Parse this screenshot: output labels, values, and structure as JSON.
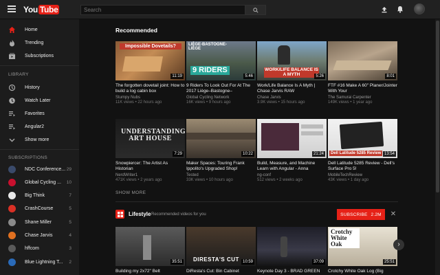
{
  "header": {
    "logo_you": "You",
    "logo_tube": "Tube",
    "search_placeholder": "Search"
  },
  "sidebar": {
    "main": [
      {
        "label": "Home",
        "icon": "home-icon"
      },
      {
        "label": "Trending",
        "icon": "flame-icon"
      },
      {
        "label": "Subscriptions",
        "icon": "subscriptions-icon"
      }
    ],
    "library_heading": "LIBRARY",
    "library": [
      {
        "label": "History",
        "icon": "history-icon"
      },
      {
        "label": "Watch Later",
        "icon": "clock-icon"
      },
      {
        "label": "Favorites",
        "icon": "heart-icon"
      },
      {
        "label": "Angular2",
        "icon": "playlist-icon"
      },
      {
        "label": "Show more",
        "icon": "chevron-down-icon"
      }
    ],
    "subscriptions_heading": "SUBSCRIPTIONS",
    "subscriptions": [
      {
        "label": "NDC Conference...",
        "count": "29",
        "color": "#3a4a6a"
      },
      {
        "label": "Global Cycling ...",
        "count": "10",
        "color": "#c8102e"
      },
      {
        "label": "Big Think",
        "count": "7",
        "color": "#e8e8e8"
      },
      {
        "label": "CrashCourse",
        "count": "5",
        "color": "#d93025"
      },
      {
        "label": "Shane Miller",
        "count": "5",
        "color": "#8a8a8a"
      },
      {
        "label": "Chase Jarvis",
        "count": "4",
        "color": "#e07020"
      },
      {
        "label": "hffcom",
        "count": "3",
        "color": "#5a5a5a"
      },
      {
        "label": "Blue Lightning T...",
        "count": "2",
        "color": "#2a6ab8"
      }
    ]
  },
  "recommended": {
    "title": "Recommended",
    "show_more": "SHOW MORE",
    "videos": [
      {
        "title": "The forgotten dovetail joint: How to build a log cabin box",
        "channel": "Stumpy Nubs",
        "meta": "11K views • 22 hours ago",
        "duration": "11:19",
        "thumb_text": "Impossible Dovetails?"
      },
      {
        "title": "9 Riders To Look Out For At The 2017 Liège–Bastogne–",
        "channel": "Global Cycling Network",
        "meta": "16K views • 9 hours ago",
        "duration": "5:46",
        "thumb_text": "9 RIDERS",
        "thumb_text2": "LIÈGE-BASTOGNE-LIÈGE"
      },
      {
        "title": "Work/Life Balance Is A Myth | Chase Jarvis RAW",
        "channel": "Chase Jarvis",
        "meta": "3.9K views • 15 hours ago",
        "duration": "5:26",
        "thumb_text": "WORK/LIFE BALANCE IS A MYTH"
      },
      {
        "title": "FTF #16 Make A 60\" Planer/Jointer With Your",
        "channel": "The Samurai Carpenter",
        "meta": "149K views • 1 year ago",
        "duration": "8:01"
      },
      {
        "title": "Snowpiercer: The Artist As Historian",
        "channel": "NerdWriter1",
        "meta": "471K views • 2 years ago",
        "duration": "7:29",
        "thumb_text": "UNDERSTANDING ART HOUSE"
      },
      {
        "title": "Maker Spaces: Touring Frank Ippolito's Upgraded Shop!",
        "channel": "Tested",
        "meta": "33K views • 10 hours ago",
        "duration": "10:22"
      },
      {
        "title": "Build, Measure, and Machine Learn with Angular - Anna",
        "channel": "ng-conf",
        "meta": "512 views • 2 weeks ago",
        "duration": "21:24"
      },
      {
        "title": "Dell Latitude 5285 Review - Dell's Surface Pro 5!",
        "channel": "MobileTechReview",
        "meta": "43K views • 1 day ago",
        "duration": "13:54",
        "thumb_text": "Dell Latitude 5285 Review"
      }
    ]
  },
  "lifestyle": {
    "title": "Lifestyle",
    "subtitle": "Recommended videos for you",
    "subscribe_label": "SUBSCRIBE",
    "subscribe_count": "2.2M",
    "videos": [
      {
        "title": "Building my 2x72\" Belt",
        "duration": "35:51"
      },
      {
        "title": "DiResta's Cut: Bin Cabinet",
        "duration": "10:59",
        "thumb_text": "DIRESTA'S CUT"
      },
      {
        "title": "Keynote Day 3 - BRAD GREEN",
        "duration": "37:09"
      },
      {
        "title": "Crotchy White Oak Log (Big",
        "duration": "25:51",
        "thumb_text": "Crotchy White Oak"
      }
    ]
  },
  "colors": {
    "brand_red": "#e62117",
    "background": "#121212",
    "sidebar": "#1c1c1c",
    "topbar": "#212121"
  }
}
